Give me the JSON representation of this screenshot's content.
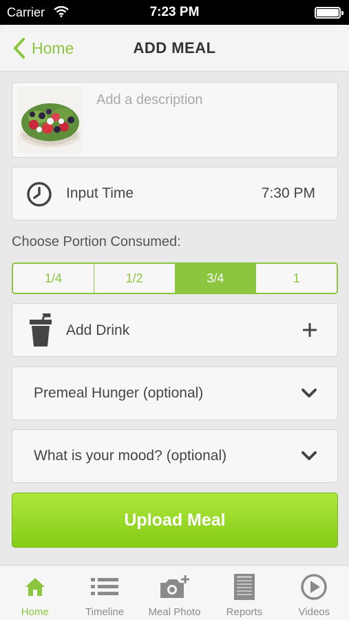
{
  "status_bar": {
    "carrier": "Carrier",
    "time": "7:23 PM"
  },
  "nav": {
    "back_label": "Home",
    "title": "ADD MEAL"
  },
  "description": {
    "placeholder": "Add a description"
  },
  "input_time": {
    "label": "Input Time",
    "value": "7:30 PM"
  },
  "portion": {
    "title": "Choose Portion Consumed:",
    "options": [
      "1/4",
      "1/2",
      "3/4",
      "1"
    ],
    "selected": "3/4"
  },
  "drink": {
    "label": "Add Drink",
    "action_icon": "plus-icon"
  },
  "premeal_hunger": {
    "label": "Premeal Hunger (optional)"
  },
  "mood": {
    "label": "What is your mood? (optional)"
  },
  "upload": {
    "label": "Upload Meal"
  },
  "tabs": [
    {
      "label": "Home",
      "icon": "home-icon",
      "active": true
    },
    {
      "label": "Timeline",
      "icon": "list-icon",
      "active": false
    },
    {
      "label": "Meal Photo",
      "icon": "camera-icon",
      "active": false
    },
    {
      "label": "Reports",
      "icon": "report-icon",
      "active": false
    },
    {
      "label": "Videos",
      "icon": "play-icon",
      "active": false
    }
  ],
  "colors": {
    "accent": "#8cc63f",
    "upload_top": "#aee63c",
    "upload_bottom": "#84cc16",
    "inactive_tab": "#8a8a8a"
  }
}
